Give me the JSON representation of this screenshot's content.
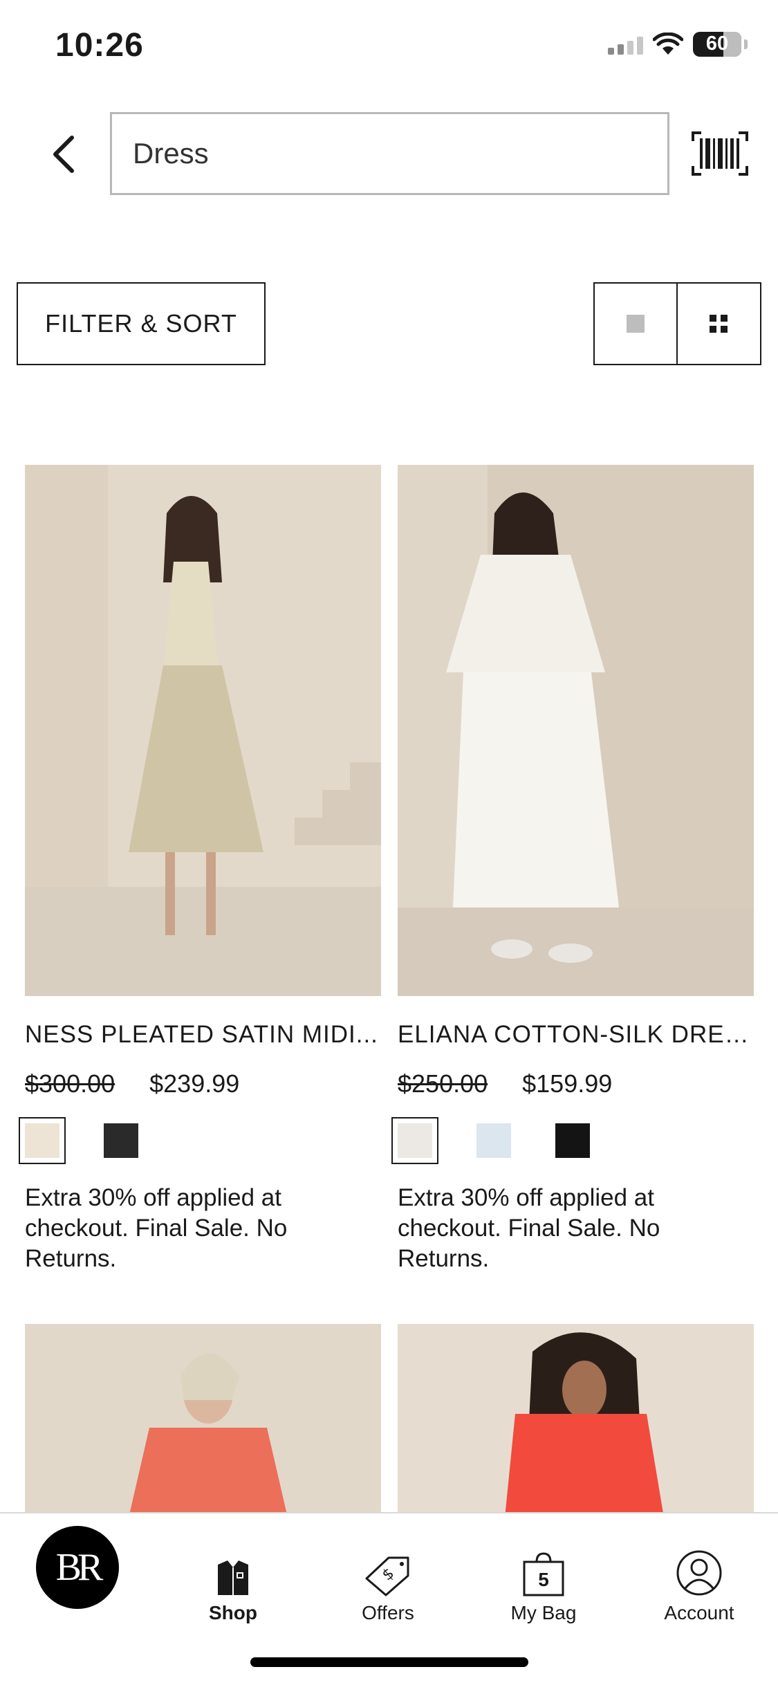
{
  "status_bar": {
    "time": "10:26",
    "battery": "60"
  },
  "search": {
    "value": "Dress"
  },
  "toolbar": {
    "filter_label": "FILTER & SORT"
  },
  "products": [
    {
      "name": "NESS PLEATED SATIN MIDI...",
      "old_price": "$300.00",
      "price": "$239.99",
      "swatches": [
        "#ede4d6",
        "#2a2a2a"
      ],
      "promo": "Extra 30% off applied at checkout. Final Sale. No Returns."
    },
    {
      "name": "ELIANA COTTON-SILK DRESS",
      "old_price": "$250.00",
      "price": "$159.99",
      "swatches": [
        "#ece9e4",
        "#dbe6ee",
        "#141414"
      ],
      "promo": "Extra 30% off applied at checkout. Final Sale. No Returns."
    }
  ],
  "tab_bar": {
    "logo": "BR",
    "shop": "Shop",
    "offers": "Offers",
    "bag": "My Bag",
    "bag_count": "5",
    "account": "Account"
  },
  "colors": {
    "photo_bg": "#e1d7c9",
    "accent": "#1a1a1a"
  }
}
